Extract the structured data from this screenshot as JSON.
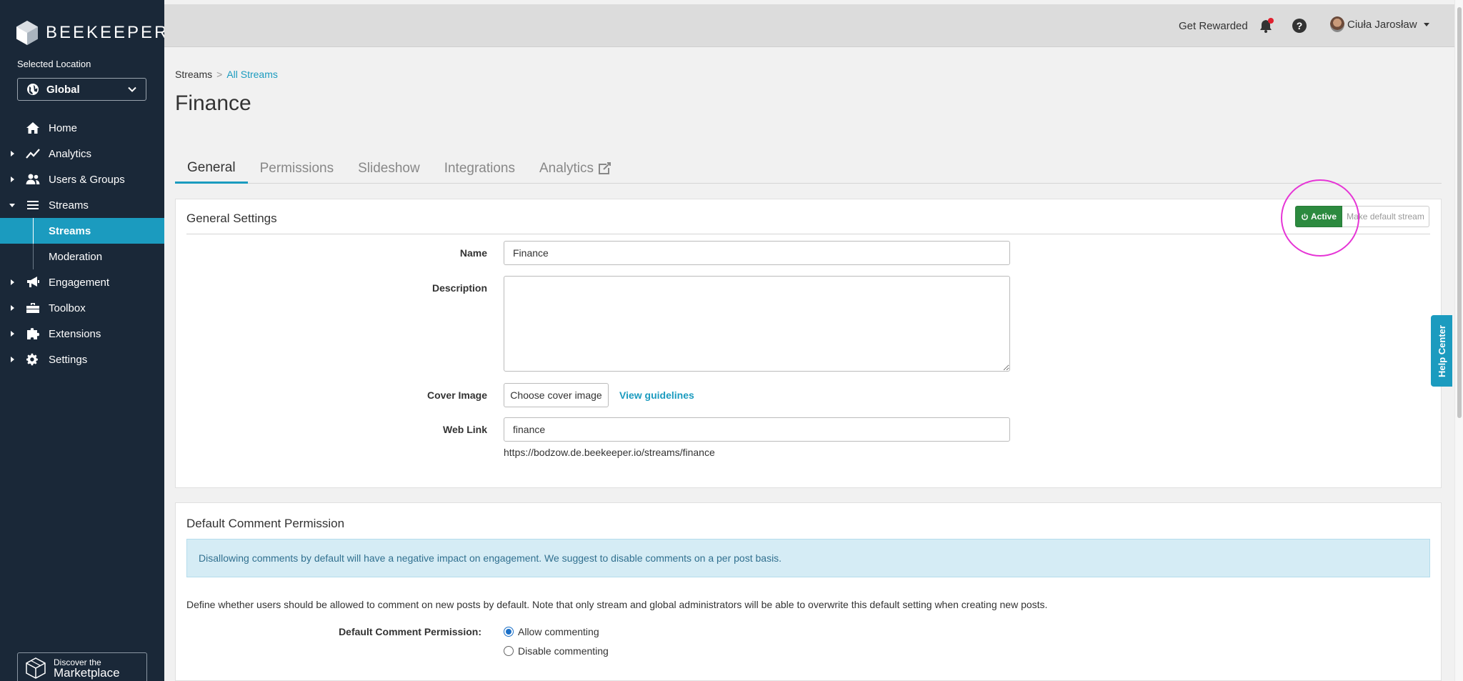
{
  "app": {
    "brand": "BEEKEEPER"
  },
  "sidebar": {
    "selected_location_label": "Selected Location",
    "location_value": "Global",
    "items": [
      {
        "label": "Home",
        "icon": "home-icon"
      },
      {
        "label": "Analytics",
        "icon": "chart-line-icon"
      },
      {
        "label": "Users & Groups",
        "icon": "users-icon"
      },
      {
        "label": "Streams",
        "icon": "list-icon"
      },
      {
        "label": "Streams",
        "icon": ""
      },
      {
        "label": "Moderation",
        "icon": ""
      },
      {
        "label": "Engagement",
        "icon": "megaphone-icon"
      },
      {
        "label": "Toolbox",
        "icon": "toolbox-icon"
      },
      {
        "label": "Extensions",
        "icon": "puzzle-icon"
      },
      {
        "label": "Settings",
        "icon": "gear-icon"
      }
    ],
    "marketplace_small": "Discover the",
    "marketplace_big": "Marketplace"
  },
  "topbar": {
    "get_rewarded": "Get Rewarded",
    "user_name": "Ciuła Jarosław"
  },
  "breadcrumb": {
    "root": "Streams",
    "separator": ">",
    "current": "All Streams"
  },
  "page": {
    "title": "Finance"
  },
  "tabs": [
    {
      "label": "General",
      "active": true
    },
    {
      "label": "Permissions",
      "active": false
    },
    {
      "label": "Slideshow",
      "active": false
    },
    {
      "label": "Integrations",
      "active": false
    },
    {
      "label": "Analytics",
      "active": false
    }
  ],
  "general_settings": {
    "title": "General Settings",
    "active_button": "Active",
    "default_button": "Make default stream",
    "name_label": "Name",
    "name_value": "Finance",
    "description_label": "Description",
    "description_value": "",
    "cover_label": "Cover Image",
    "cover_button": "Choose cover image",
    "view_guidelines": "View guidelines",
    "web_link_label": "Web Link",
    "web_link_value": "finance",
    "url": "https://bodzow.de.beekeeper.io/streams/finance"
  },
  "comment_permission": {
    "title": "Default Comment Permission",
    "info": "Disallowing comments by default will have a negative impact on engagement. We suggest to disable comments on a per post basis.",
    "description": "Define whether users should be allowed to comment on new posts by default. Note that only stream and global administrators will be able to overwrite this default setting when creating new posts.",
    "label": "Default Comment Permission:",
    "options": [
      {
        "label": "Allow commenting",
        "checked": true
      },
      {
        "label": "Disable commenting",
        "checked": false
      }
    ]
  },
  "help_center": "Help Center",
  "colors": {
    "sidebar_bg": "#1a2838",
    "accent": "#1b9bbf",
    "active_green": "#2c8a3f",
    "highlight_ring": "#e635d6",
    "notification_dot": "#e0202e"
  }
}
